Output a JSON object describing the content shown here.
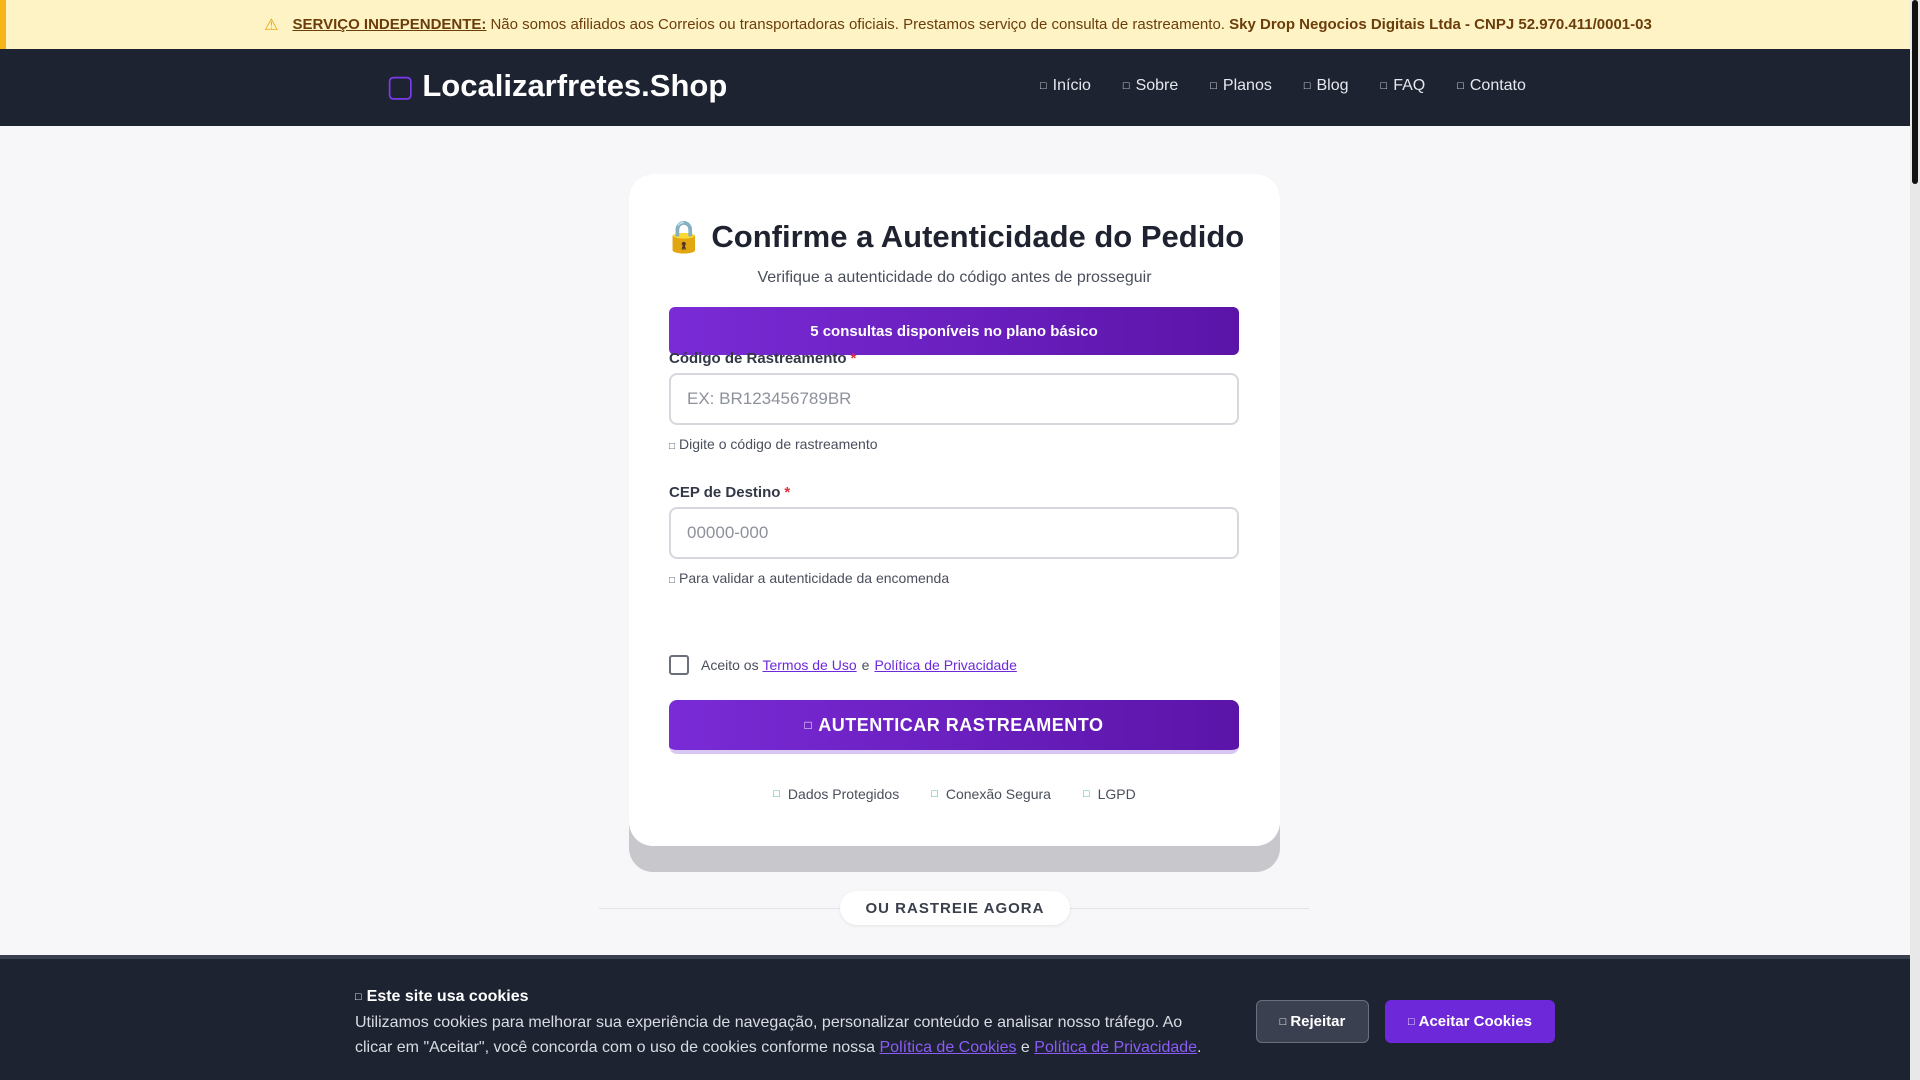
{
  "notice": {
    "icon": "warning-icon",
    "strong": "SERVIÇO INDEPENDENTE:",
    "message": "Não somos afiliados aos Correios ou transportadoras oficiais. Prestamos serviço de consulta de rastreamento.",
    "company": "Sky Drop Negocios Digitais Ltda - CNPJ 52.970.411/0001-03"
  },
  "brand": {
    "icon": "box-icon",
    "name": "Localizarfretes.Shop",
    "accent_color": "#7c3aed"
  },
  "nav": {
    "items": [
      {
        "label": "Início",
        "icon": "home-icon"
      },
      {
        "label": "Sobre",
        "icon": "info-icon"
      },
      {
        "label": "Planos",
        "icon": "tag-icon"
      },
      {
        "label": "Blog",
        "icon": "blog-icon"
      },
      {
        "label": "FAQ",
        "icon": "question-icon"
      },
      {
        "label": "Contato",
        "icon": "mail-icon"
      }
    ]
  },
  "card": {
    "title_emoji": "🔒",
    "title": "Confirme a Autenticidade do Pedido",
    "subtitle": "Verifique a autenticidade do código antes de prosseguir",
    "plan_banner": "5 consultas disponíveis no plano básico",
    "tracking": {
      "label": "Código de Rastreamento",
      "required": "*",
      "placeholder": "EX: BR123456789BR",
      "value": "",
      "hint": "Digite o código de rastreamento"
    },
    "cep": {
      "label": "CEP de Destino",
      "required": "*",
      "placeholder": "00000-000",
      "value": "",
      "hint": "Para validar a autenticidade da encomenda"
    },
    "terms": {
      "prefix": "Aceito os",
      "terms_link": "Termos de Uso",
      "conjunction": "e",
      "privacy_link": "Política de Privacidade",
      "checked": false
    },
    "submit_label": "AUTENTICAR RASTREAMENTO",
    "badges": [
      {
        "label": "Dados Protegidos",
        "icon": "shield-icon"
      },
      {
        "label": "Conexão Segura",
        "icon": "lock-icon"
      },
      {
        "label": "LGPD",
        "icon": "check-icon"
      }
    ]
  },
  "divider_label": "OU RASTREIE AGORA",
  "cookie": {
    "title": "Este site usa cookies",
    "text": "Utilizamos cookies para melhorar sua experiência de navegação, personalizar conteúdo e analisar nosso tráfego. Ao clicar em \"Aceitar\", você concorda com o uso de cookies conforme nossa",
    "cookie_policy_link": "Política de Cookies",
    "conjunction": "e",
    "privacy_link": "Política de Privacidade",
    "end": ".",
    "reject_label": "Rejeitar",
    "accept_label": "Aceitar Cookies"
  },
  "colors": {
    "primary": "#6d28d9",
    "nav_bg": "#1d2330",
    "notice_bg": "#fdf3c5",
    "success": "#22b47a"
  }
}
